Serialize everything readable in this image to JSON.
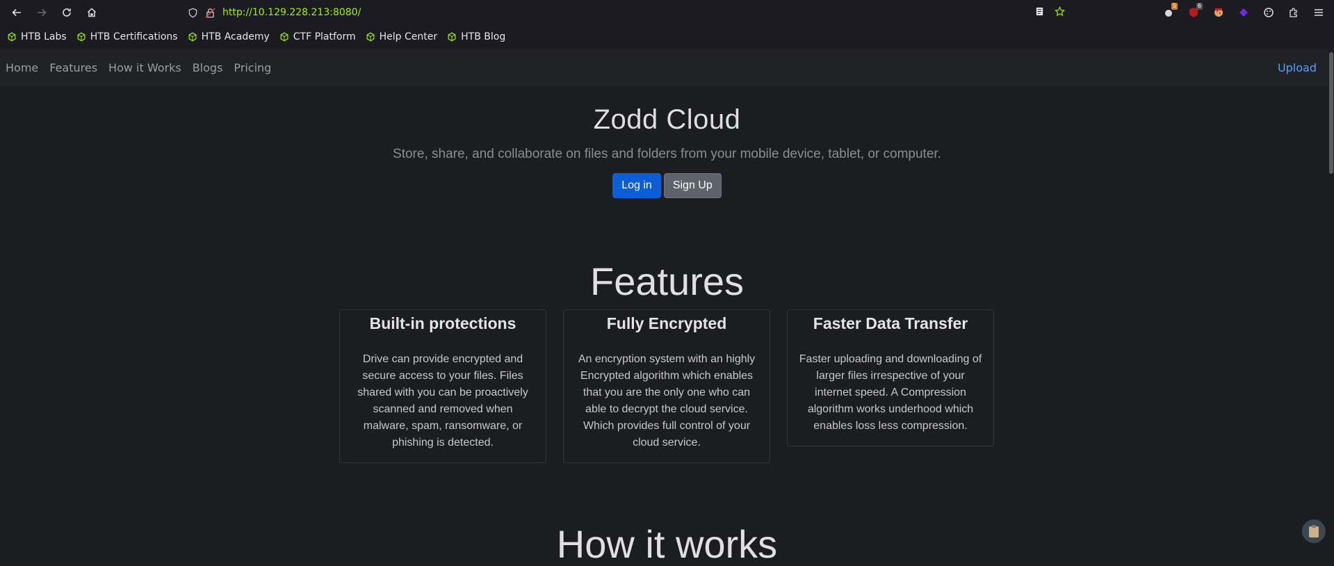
{
  "browser": {
    "url_scheme": "http://",
    "url_host": "10.129.228.213",
    "url_port": ":8080/",
    "extension_badges": [
      "5",
      "6"
    ]
  },
  "bookmarks": [
    {
      "label": "HTB Labs"
    },
    {
      "label": "HTB Certifications"
    },
    {
      "label": "HTB Academy"
    },
    {
      "label": "CTF Platform"
    },
    {
      "label": "Help Center"
    },
    {
      "label": "HTB Blog"
    }
  ],
  "nav": {
    "items": [
      {
        "label": "Home"
      },
      {
        "label": "Features"
      },
      {
        "label": "How it Works"
      },
      {
        "label": "Blogs"
      },
      {
        "label": "Pricing"
      }
    ],
    "upload": "Upload"
  },
  "hero": {
    "title": "Zodd Cloud",
    "subtitle": "Store, share, and collaborate on files and folders from your mobile device, tablet, or computer.",
    "login": "Log in",
    "signup": "Sign Up"
  },
  "features": {
    "title": "Features",
    "cards": [
      {
        "title": "Built-in protections",
        "text": "Drive can provide encrypted and secure access to your files. Files shared with you can be proactively scanned and removed when malware, spam, ransomware, or phishing is detected."
      },
      {
        "title": "Fully Encrypted",
        "text": "An encryption system with an highly Encrypted algorithm which enables that you are the only one who can able to decrypt the cloud service. Which provides full control of your cloud service."
      },
      {
        "title": "Faster Data Transfer",
        "text": "Faster uploading and downloading of larger files irrespective of your internet speed. A Compression algorithm works underhood which enables loss less compression."
      }
    ]
  },
  "how_it_works": {
    "title": "How it works"
  },
  "colors": {
    "accent": "#9fef00",
    "primary_button": "#0b5ed7",
    "link": "#4ea3ff"
  }
}
